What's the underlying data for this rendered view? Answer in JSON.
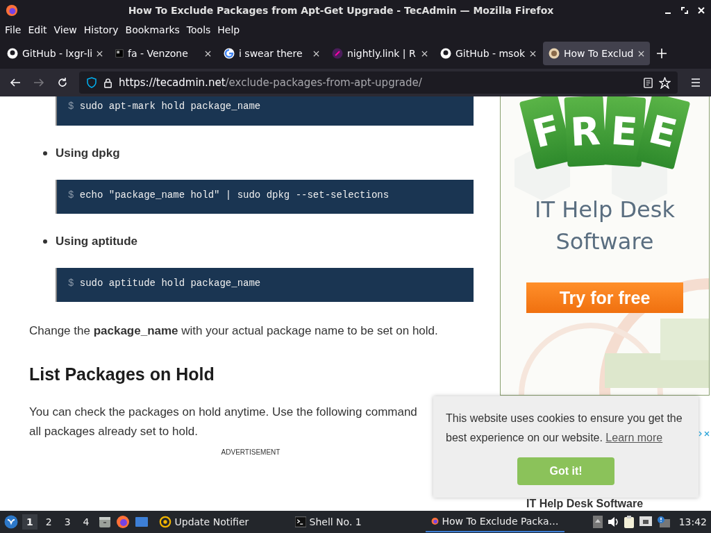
{
  "window": {
    "title": "How To Exclude Packages from Apt-Get Upgrade - TecAdmin — Mozilla Firefox"
  },
  "menu": [
    "File",
    "Edit",
    "View",
    "History",
    "Bookmarks",
    "Tools",
    "Help"
  ],
  "tabs": [
    {
      "label": "GitHub - lxgr-li",
      "kind": "github",
      "selected": false
    },
    {
      "label": "fa - Venzone",
      "kind": "square",
      "selected": false
    },
    {
      "label": "i swear there",
      "kind": "google",
      "selected": false
    },
    {
      "label": "nightly.link | R",
      "kind": "link",
      "selected": false
    },
    {
      "label": "GitHub - msok",
      "kind": "github",
      "selected": false
    },
    {
      "label": "How To Exclud",
      "kind": "site",
      "selected": true
    }
  ],
  "address": {
    "host": "https://tecadmin.net",
    "path": "/exclude-packages-from-apt-upgrade/"
  },
  "article": [
    {
      "kind": "code",
      "prompt": "$",
      "text": "sudo apt-mark hold package_name"
    },
    {
      "kind": "bullet",
      "text": "Using dpkg"
    },
    {
      "kind": "code",
      "prompt": "$",
      "text": "echo \"package_name hold\" | sudo dpkg --set-selections"
    },
    {
      "kind": "bullet",
      "text": "Using aptitude"
    },
    {
      "kind": "code",
      "prompt": "$",
      "text": "sudo aptitude hold package_name"
    },
    {
      "kind": "para",
      "text": "Change the **package_name** with your actual package name to be set on hold."
    },
    {
      "kind": "heading",
      "text": "List Packages on Hold"
    },
    {
      "kind": "para",
      "text": "You can check the packages on hold anytime. Use the following command"
    },
    {
      "kind": "para",
      "text": "all packages already set to hold."
    },
    {
      "kind": "ad_label",
      "text": "ADVERTISEMENT"
    }
  ],
  "ad": {
    "tag_letters": [
      "F",
      "R",
      "E",
      "E"
    ],
    "headline": "IT Help Desk Software",
    "button": "Try for free"
  },
  "ad_lower": {
    "headline": "IT Help Desk Software"
  },
  "cookie": {
    "text": "This website uses cookies to ensure you get the best experience on our website.",
    "link": "Learn more",
    "button": "Got it!"
  },
  "taskbar": {
    "workspaces": [
      {
        "label": "1",
        "selected": true
      },
      {
        "label": "2",
        "selected": false
      },
      {
        "label": "3",
        "selected": false
      },
      {
        "label": "4",
        "selected": false
      }
    ],
    "tasks": [
      {
        "label": "Update Notifier",
        "kind": "notifier",
        "selected": false
      },
      {
        "label": "Shell No. 1",
        "kind": "shell",
        "selected": false
      },
      {
        "label": "How To Exclude Packa…",
        "kind": "firefox",
        "selected": true
      }
    ],
    "clock": "13:42"
  }
}
